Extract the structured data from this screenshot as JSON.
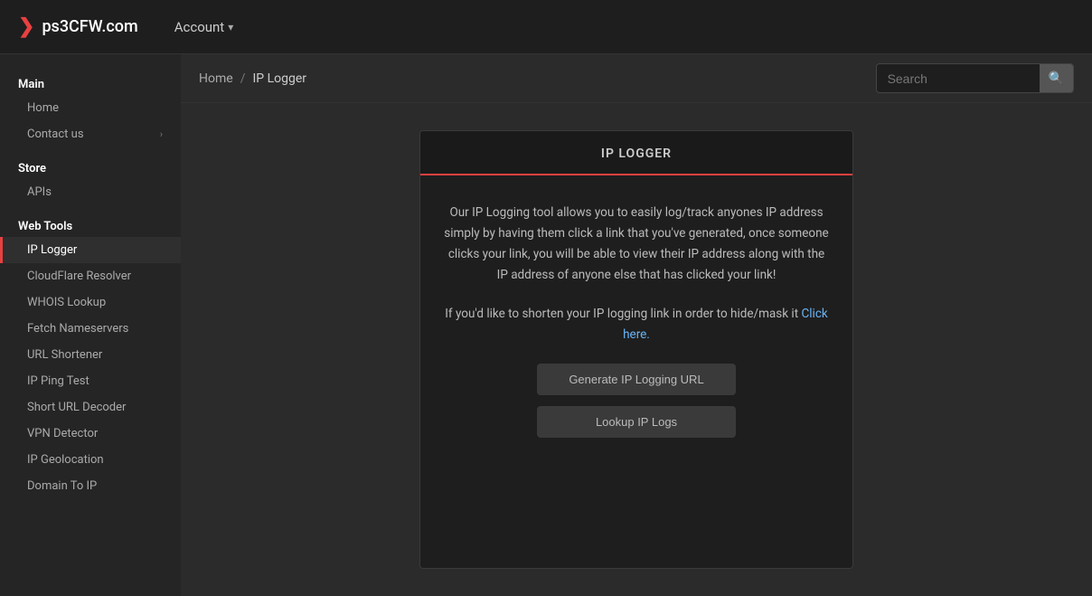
{
  "navbar": {
    "brand_name": "ps3CFW.com",
    "brand_icon": "❯",
    "account_label": "Account",
    "account_chevron": "▾"
  },
  "sidebar": {
    "sections": [
      {
        "label": "Main",
        "items": [
          {
            "id": "home",
            "text": "Home",
            "active": false,
            "has_chevron": false
          },
          {
            "id": "contact-us",
            "text": "Contact us",
            "active": false,
            "has_chevron": true
          }
        ]
      },
      {
        "label": "Store",
        "items": [
          {
            "id": "apis",
            "text": "APIs",
            "active": false,
            "has_chevron": false
          }
        ]
      },
      {
        "label": "Web Tools",
        "items": [
          {
            "id": "ip-logger",
            "text": "IP Logger",
            "active": true,
            "has_chevron": false
          },
          {
            "id": "cloudflare-resolver",
            "text": "CloudFlare Resolver",
            "active": false,
            "has_chevron": false
          },
          {
            "id": "whois-lookup",
            "text": "WHOIS Lookup",
            "active": false,
            "has_chevron": false
          },
          {
            "id": "fetch-nameservers",
            "text": "Fetch Nameservers",
            "active": false,
            "has_chevron": false
          },
          {
            "id": "url-shortener",
            "text": "URL Shortener",
            "active": false,
            "has_chevron": false
          },
          {
            "id": "ip-ping-test",
            "text": "IP Ping Test",
            "active": false,
            "has_chevron": false
          },
          {
            "id": "short-url-decoder",
            "text": "Short URL Decoder",
            "active": false,
            "has_chevron": false
          },
          {
            "id": "vpn-detector",
            "text": "VPN Detector",
            "active": false,
            "has_chevron": false
          },
          {
            "id": "ip-geolocation",
            "text": "IP Geolocation",
            "active": false,
            "has_chevron": false
          },
          {
            "id": "domain-to-ip",
            "text": "Domain To IP",
            "active": false,
            "has_chevron": false
          }
        ]
      }
    ]
  },
  "breadcrumb": {
    "home": "Home",
    "separator": "/",
    "current": "IP Logger"
  },
  "search": {
    "placeholder": "Search",
    "button_icon": "🔍"
  },
  "card": {
    "title": "IP LOGGER",
    "description_1": "Our IP Logging tool allows you to easily log/track anyones IP address simply by having them click a link that you've generated, once someone clicks your link, you will be able to view their IP address along with the IP address of anyone else that has clicked your link!",
    "description_2": "If you'd like to shorten your IP logging link in order to hide/mask it",
    "click_here": "Click here.",
    "btn_generate": "Generate IP Logging URL",
    "btn_lookup": "Lookup IP Logs"
  }
}
